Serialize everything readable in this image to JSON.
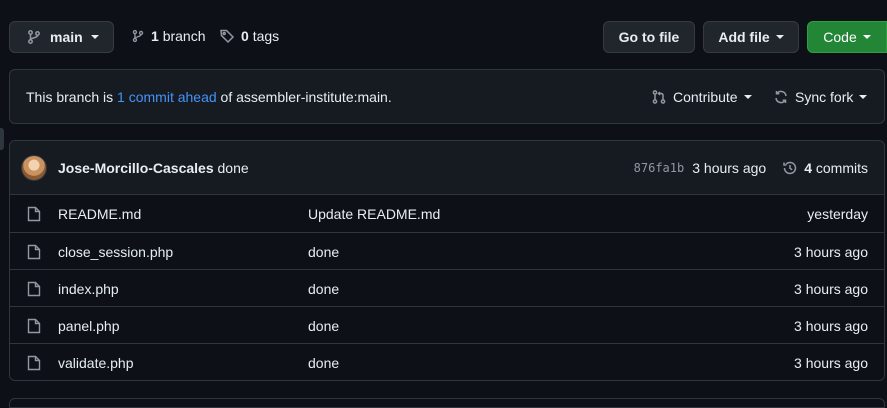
{
  "toolbar": {
    "branch_select": "main",
    "branch_count": "1",
    "branch_label": "branch",
    "tag_count": "0",
    "tag_label": "tags",
    "go_to_file": "Go to file",
    "add_file": "Add file",
    "code": "Code"
  },
  "banner": {
    "prefix": "This branch is ",
    "link": "1 commit ahead",
    "suffix": " of assembler-institute:main.",
    "contribute": "Contribute",
    "sync_fork": "Sync fork"
  },
  "latest_commit": {
    "author": "Jose-Morcillo-Cascales",
    "message": "done",
    "sha": "876fa1b",
    "time": "3 hours ago",
    "commit_count": "4",
    "commit_label": "commits"
  },
  "files": [
    {
      "name": "README.md",
      "message": "Update README.md",
      "age": "yesterday"
    },
    {
      "name": "close_session.php",
      "message": "done",
      "age": "3 hours ago"
    },
    {
      "name": "index.php",
      "message": "done",
      "age": "3 hours ago"
    },
    {
      "name": "panel.php",
      "message": "done",
      "age": "3 hours ago"
    },
    {
      "name": "validate.php",
      "message": "done",
      "age": "3 hours ago"
    }
  ],
  "colors": {
    "background": "#0d1117",
    "panel": "#161b22",
    "border": "#30363d",
    "link": "#4493f8",
    "code_button": "#238636"
  },
  "icons": [
    "git-branch-icon",
    "tag-icon",
    "git-pull-request-icon",
    "sync-icon",
    "history-icon",
    "file-icon"
  ]
}
